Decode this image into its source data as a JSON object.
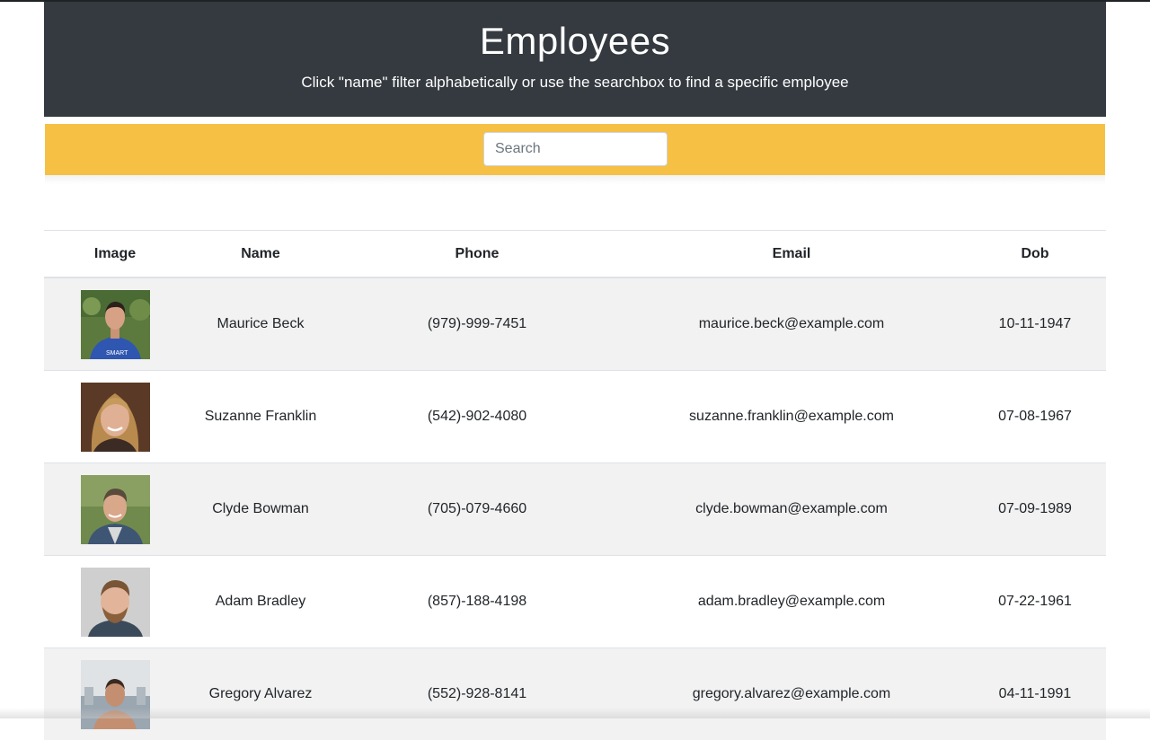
{
  "header": {
    "title": "Employees",
    "subtitle": "Click \"name\" filter alphabetically or use the searchbox to find a specific employee"
  },
  "search": {
    "placeholder": "Search",
    "value": ""
  },
  "table": {
    "columns": [
      "Image",
      "Name",
      "Phone",
      "Email",
      "Dob"
    ],
    "rows": [
      {
        "image": "employee-photo",
        "name": "Maurice Beck",
        "phone": "(979)-999-7451",
        "email": "maurice.beck@example.com",
        "dob": "10-11-1947"
      },
      {
        "image": "employee-photo",
        "name": "Suzanne Franklin",
        "phone": "(542)-902-4080",
        "email": "suzanne.franklin@example.com",
        "dob": "07-08-1967"
      },
      {
        "image": "employee-photo",
        "name": "Clyde Bowman",
        "phone": "(705)-079-4660",
        "email": "clyde.bowman@example.com",
        "dob": "07-09-1989"
      },
      {
        "image": "employee-photo",
        "name": "Adam Bradley",
        "phone": "(857)-188-4198",
        "email": "adam.bradley@example.com",
        "dob": "07-22-1961"
      },
      {
        "image": "employee-photo",
        "name": "Gregory Alvarez",
        "phone": "(552)-928-8141",
        "email": "gregory.alvarez@example.com",
        "dob": "04-11-1991"
      }
    ]
  },
  "colors": {
    "header_bg": "#343a40",
    "search_bar_bg": "#f5c044",
    "striped_row_bg": "#f2f2f2"
  }
}
